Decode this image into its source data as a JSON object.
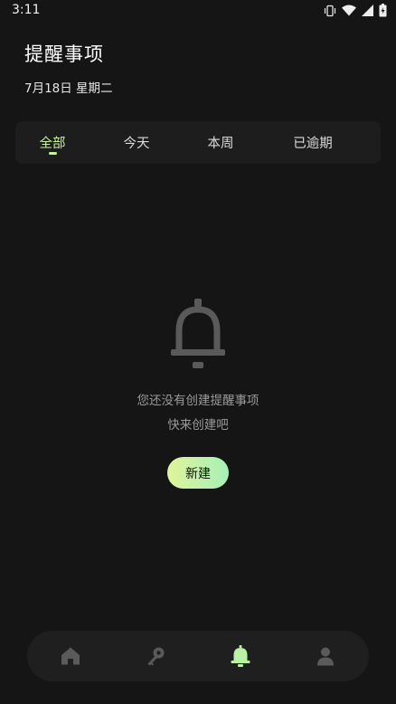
{
  "status_bar": {
    "time": "3:11",
    "icons": [
      "vibrate-icon",
      "wifi-icon",
      "signal-icon",
      "battery-icon"
    ]
  },
  "header": {
    "title": "提醒事项",
    "date": "7月18日 星期二"
  },
  "tabs": [
    {
      "label": "全部",
      "active": true
    },
    {
      "label": "今天",
      "active": false
    },
    {
      "label": "本周",
      "active": false
    },
    {
      "label": "已逾期",
      "active": false
    }
  ],
  "empty_state": {
    "icon": "bell-icon",
    "line1": "您还没有创建提醒事项",
    "line2": "快来创建吧",
    "button_label": "新建"
  },
  "bottom_nav": {
    "items": [
      {
        "icon": "home-icon",
        "active": false
      },
      {
        "icon": "key-icon",
        "active": false
      },
      {
        "icon": "bell-icon",
        "active": true
      },
      {
        "icon": "profile-icon",
        "active": false
      }
    ]
  },
  "colors": {
    "background": "#151515",
    "accent": "#c8f39a",
    "tab_bar": "#1d1d1d",
    "nav_bar": "#1f1f1f",
    "inactive_icon": "#5a5a5a",
    "muted_text": "#9a9a9a",
    "button_gradient_start": "#e0f59a",
    "button_gradient_end": "#a6f0b8"
  }
}
